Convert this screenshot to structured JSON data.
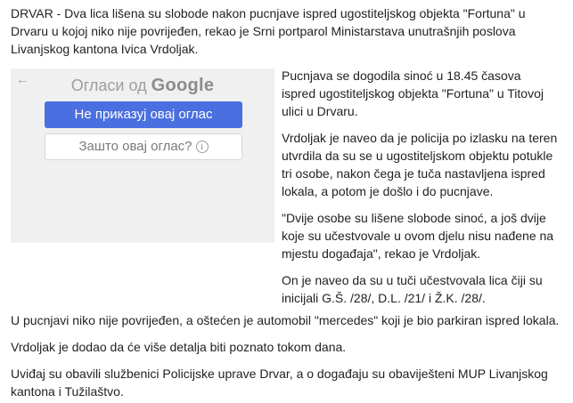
{
  "article": {
    "intro": "DRVAR - Dva lica lišena su slobode nakon pucnjave ispred ugostiteljskog objekta \"Fortuna\" u Drvaru u kojoj niko nije povrijeđen, rekao je Srni portparol Ministarstava unutrašnjih poslova Livanjskog kantona Ivica Vrdoljak.",
    "side_paragraphs": [
      "Pucnjava se dogodila sinoć u 18.45 časova ispred ugostiteljskog objekta \"Fortuna\" u Titovoj ulici u Drvaru.",
      "Vrdoljak je naveo da je policija po izlasku na teren utvrdila da su se u ugostiteljskom objektu potukle tri osobe, nakon čega je tuča nastavljena ispred lokala, a potom je došlo i do pucnjave.",
      "\"Dvije osobe su lišene slobode sinoć, a još dvije koje su učestvovale u ovom djelu nisu nađene na mjestu događaja\", rekao je Vrdoljak.",
      "On je naveo da su u tuči učestvovala lica čiji su inicijali G.Š. /28/, D.L. /21/ i Ž.K. /28/."
    ],
    "bottom_paragraphs": [
      "U pucnjavi niko nije povrijeđen, a oštećen je automobil \"mercedes\" koji je bio parkiran ispred lokala.",
      "Vrdoljak je dodao da će više detalja biti poznato tokom dana.",
      "Uviđaj su obavili službenici Policijske uprave Drvar, a o događaju su obaviješteni MUP Livanjskog kantona i Tužilaštvo."
    ]
  },
  "ad": {
    "back_icon": "arrow-left-icon",
    "header_prefix": "Огласи од",
    "brand": "Google",
    "hide_button": "Не приказуј овај оглас",
    "why_button": "Зашто овај оглас?",
    "info_icon": "info-icon",
    "colors": {
      "panel": "#f0f0f0",
      "primary_button": "#4a6fe0"
    }
  }
}
